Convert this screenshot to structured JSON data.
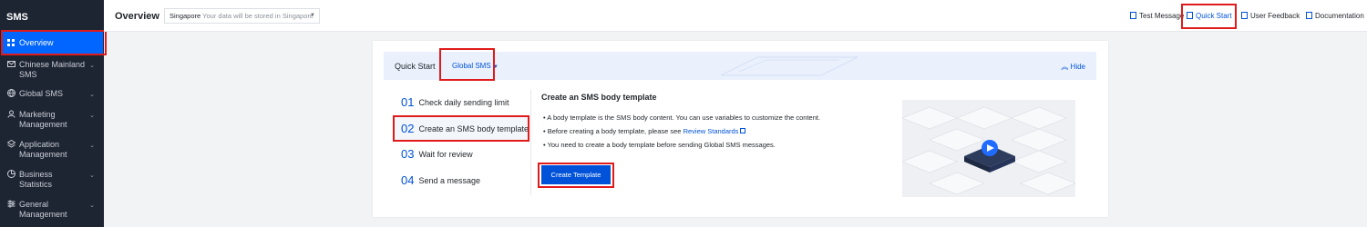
{
  "sidebar": {
    "brand": "SMS",
    "active_item": "Overview",
    "items": [
      {
        "label": "Chinese Mainland SMS",
        "line1": "Chinese Mainland",
        "line2": "SMS"
      },
      {
        "label": "Global SMS",
        "line1": "Global SMS",
        "line2": ""
      },
      {
        "label": "Marketing Management",
        "line1": "Marketing",
        "line2": "Management"
      },
      {
        "label": "Application Management",
        "line1": "Application",
        "line2": "Management"
      },
      {
        "label": "Business Statistics",
        "line1": "Business",
        "line2": "Statistics"
      },
      {
        "label": "General Management",
        "line1": "General",
        "line2": "Management"
      }
    ]
  },
  "header": {
    "title": "Overview",
    "region": "Singapore",
    "region_hint": "Your data will be stored in Singapore",
    "links": {
      "test_message": "Test Message",
      "quick_start": "Quick Start",
      "user_feedback": "User Feedback",
      "documentation": "Documentation"
    }
  },
  "quick_start": {
    "title": "Quick Start",
    "selector": "Global SMS",
    "hide": "Hide",
    "steps": [
      {
        "num": "01",
        "label": "Check daily sending limit"
      },
      {
        "num": "02",
        "label": "Create an SMS body template"
      },
      {
        "num": "03",
        "label": "Wait for review"
      },
      {
        "num": "04",
        "label": "Send a message"
      }
    ],
    "detail": {
      "title": "Create an SMS body template",
      "bullet1": "• A body template is the SMS body content. You can use variables to customize the content.",
      "bullet2_prefix": "• Before creating a body template, please see ",
      "bullet2_link": "Review Standards",
      "bullet3": "• You need to create a body template before sending Global SMS messages.",
      "button": "Create Template"
    }
  },
  "colors": {
    "accent": "#0052d9",
    "sidebar_bg": "#1d2432",
    "active": "#0066ff",
    "highlight": "#e01b1b"
  }
}
